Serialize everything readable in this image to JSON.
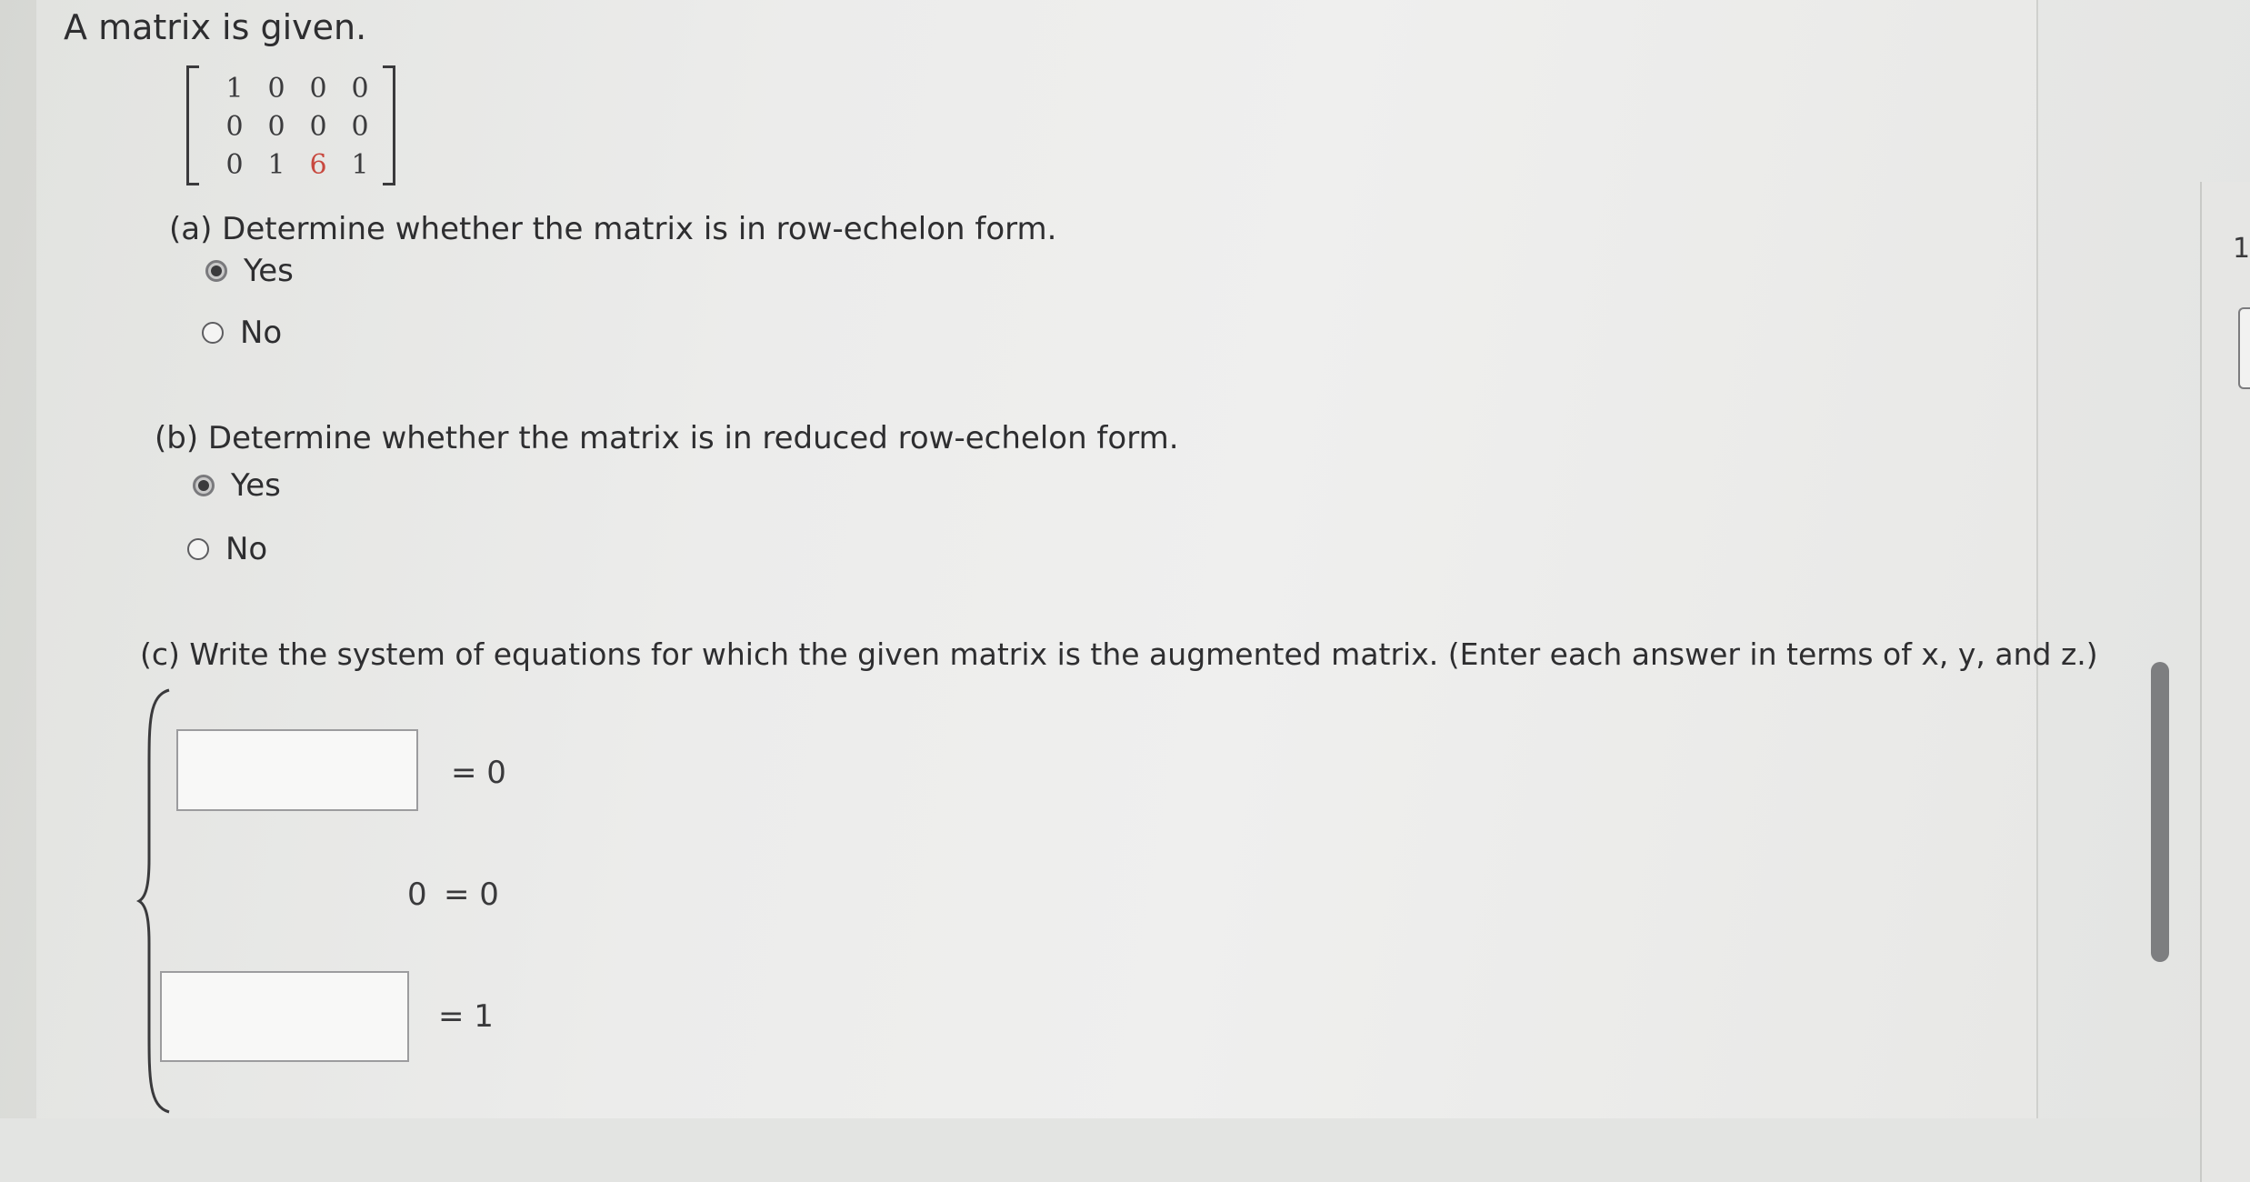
{
  "title": "A matrix is given.",
  "matrix": {
    "rows": [
      [
        "1",
        "0",
        "0",
        "0"
      ],
      [
        "0",
        "0",
        "0",
        "0"
      ],
      [
        "0",
        "1",
        "6",
        "1"
      ]
    ],
    "highlight_color": "#c8493f"
  },
  "part_a": {
    "question": "(a) Determine whether the matrix is in row-echelon form.",
    "options": [
      {
        "label": "Yes",
        "selected": true
      },
      {
        "label": "No",
        "selected": false
      }
    ]
  },
  "part_b": {
    "question": "(b) Determine whether the matrix is in reduced row-echelon form.",
    "options": [
      {
        "label": "Yes",
        "selected": true
      },
      {
        "label": "No",
        "selected": false
      }
    ]
  },
  "part_c": {
    "question": "(c) Write the system of equations for which the given matrix is the augmented matrix. (Enter each answer in terms of x, y, and z.)",
    "equations": [
      {
        "lhs_value": "",
        "rhs": "= 0"
      },
      {
        "lhs_text": "0",
        "rhs": "= 0"
      },
      {
        "lhs_value": "",
        "rhs": "= 1"
      }
    ]
  },
  "side_panel": {
    "number": "1"
  }
}
